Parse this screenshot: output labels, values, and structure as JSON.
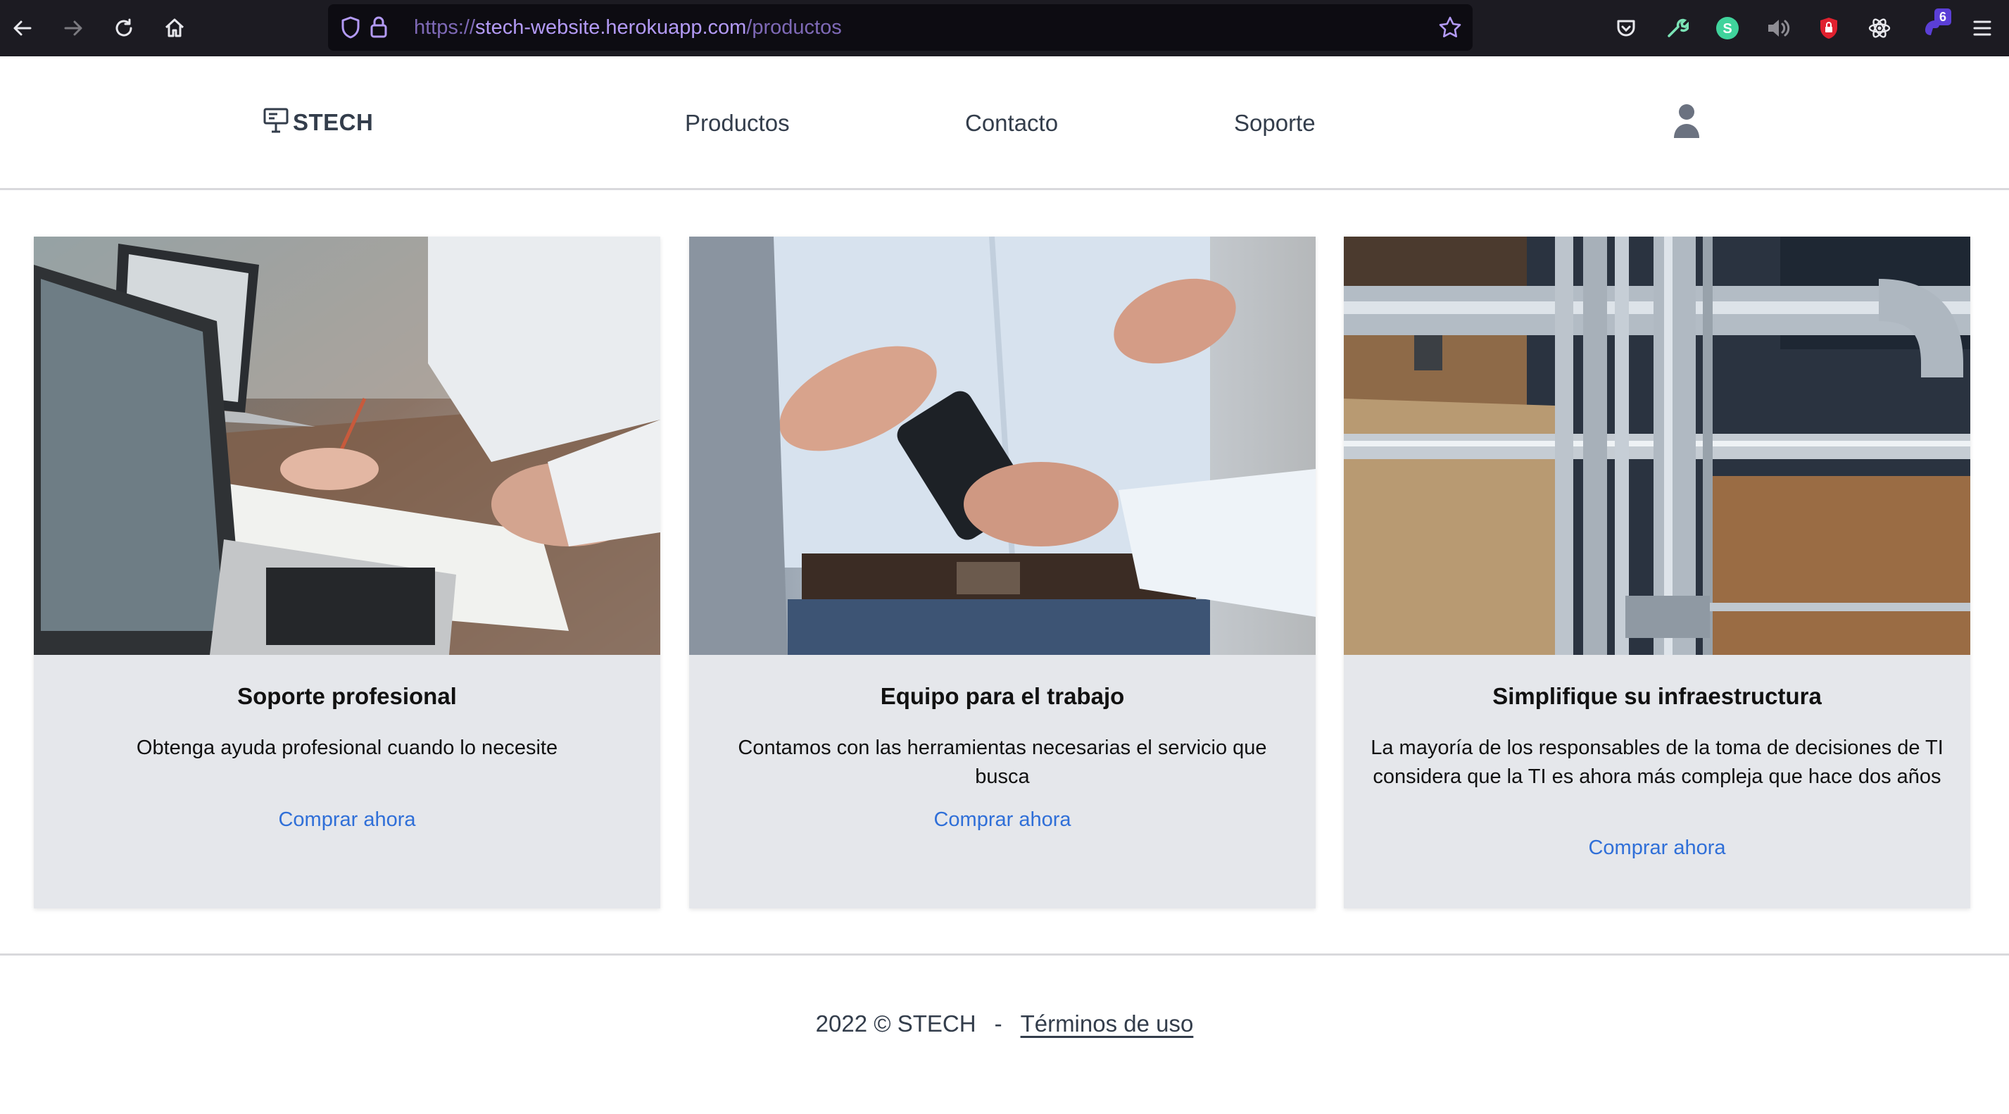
{
  "browser": {
    "url_scheme": "https://",
    "url_host": "stech-website.herokuapp.com",
    "url_path": "/productos",
    "extension_badge": "6"
  },
  "header": {
    "logo_text": "STECH",
    "nav": [
      "Productos",
      "Contacto",
      "Soporte"
    ]
  },
  "cards": [
    {
      "title": "Soporte profesional",
      "description": "Obtenga ayuda profesional cuando lo necesite",
      "link": "Comprar ahora"
    },
    {
      "title": "Equipo para el trabajo",
      "description": "Contamos con las herramientas necesarias el servicio que busca",
      "link": "Comprar ahora"
    },
    {
      "title": "Simplifique su infraestructura",
      "description": "La mayoría de los responsables de la toma de decisiones de TI considera que la TI es ahora más compleja que hace dos años",
      "link": "Comprar ahora"
    }
  ],
  "footer": {
    "copyright": "2022 © STECH",
    "separator": "-",
    "terms": "Términos de uso"
  },
  "colors": {
    "browser_bar": "#1c1b22",
    "url_text": "#9d7ae6",
    "text": "#333d4b",
    "card_bg": "#e5e7eb",
    "link": "#2f6fd8"
  },
  "icons": [
    "back-arrow-icon",
    "forward-arrow-icon",
    "reload-icon",
    "home-icon",
    "shield-icon",
    "lock-icon",
    "star-icon",
    "pocket-icon",
    "wrench-icon",
    "extension-s-icon",
    "speaker-icon",
    "shield-lock-icon",
    "react-icon",
    "extension-purple-icon",
    "menu-icon",
    "presentation-logo-icon",
    "user-icon"
  ]
}
